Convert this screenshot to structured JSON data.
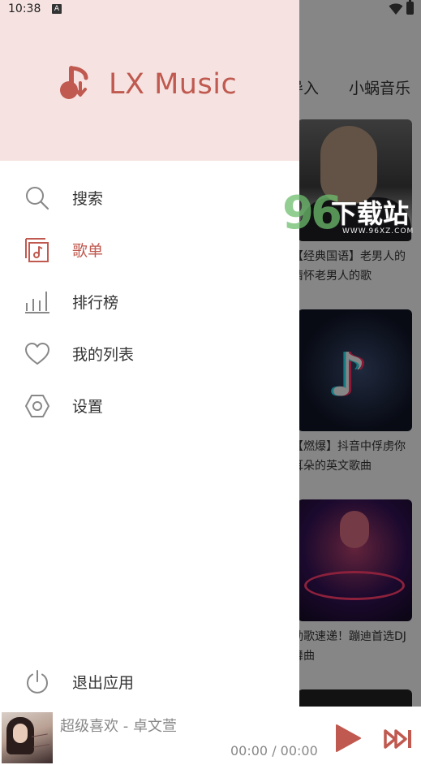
{
  "status_bar": {
    "time": "10:38",
    "badge": "A"
  },
  "background": {
    "tabs": [
      "导入",
      "小蜗音乐"
    ],
    "cards": [
      {
        "caption": "【经典国语】老男人的情怀老男人的歌"
      },
      {
        "caption": "【燃爆】抖音中俘虏你耳朵的英文歌曲"
      },
      {
        "caption": "劲歌速递！蹦迪首选DJ舞曲"
      }
    ]
  },
  "watermark": {
    "number": "96",
    "text": "下载站",
    "url": "WWW.96XZ.COM"
  },
  "drawer": {
    "app_name": "LX Music",
    "menu": [
      {
        "label": "搜索",
        "icon": "search-icon",
        "active": false
      },
      {
        "label": "歌单",
        "icon": "playlist-icon",
        "active": true
      },
      {
        "label": "排行榜",
        "icon": "leaderboard-icon",
        "active": false
      },
      {
        "label": "我的列表",
        "icon": "heart-icon",
        "active": false
      },
      {
        "label": "设置",
        "icon": "settings-icon",
        "active": false
      }
    ],
    "exit": {
      "label": "退出应用",
      "icon": "power-icon"
    }
  },
  "player": {
    "title": "超级喜欢 - 卓文萱",
    "time": "00:00 / 00:00"
  },
  "colors": {
    "accent": "#c0594f",
    "header_bg": "#f6e3e1",
    "text": "#333333",
    "muted": "#888888"
  }
}
